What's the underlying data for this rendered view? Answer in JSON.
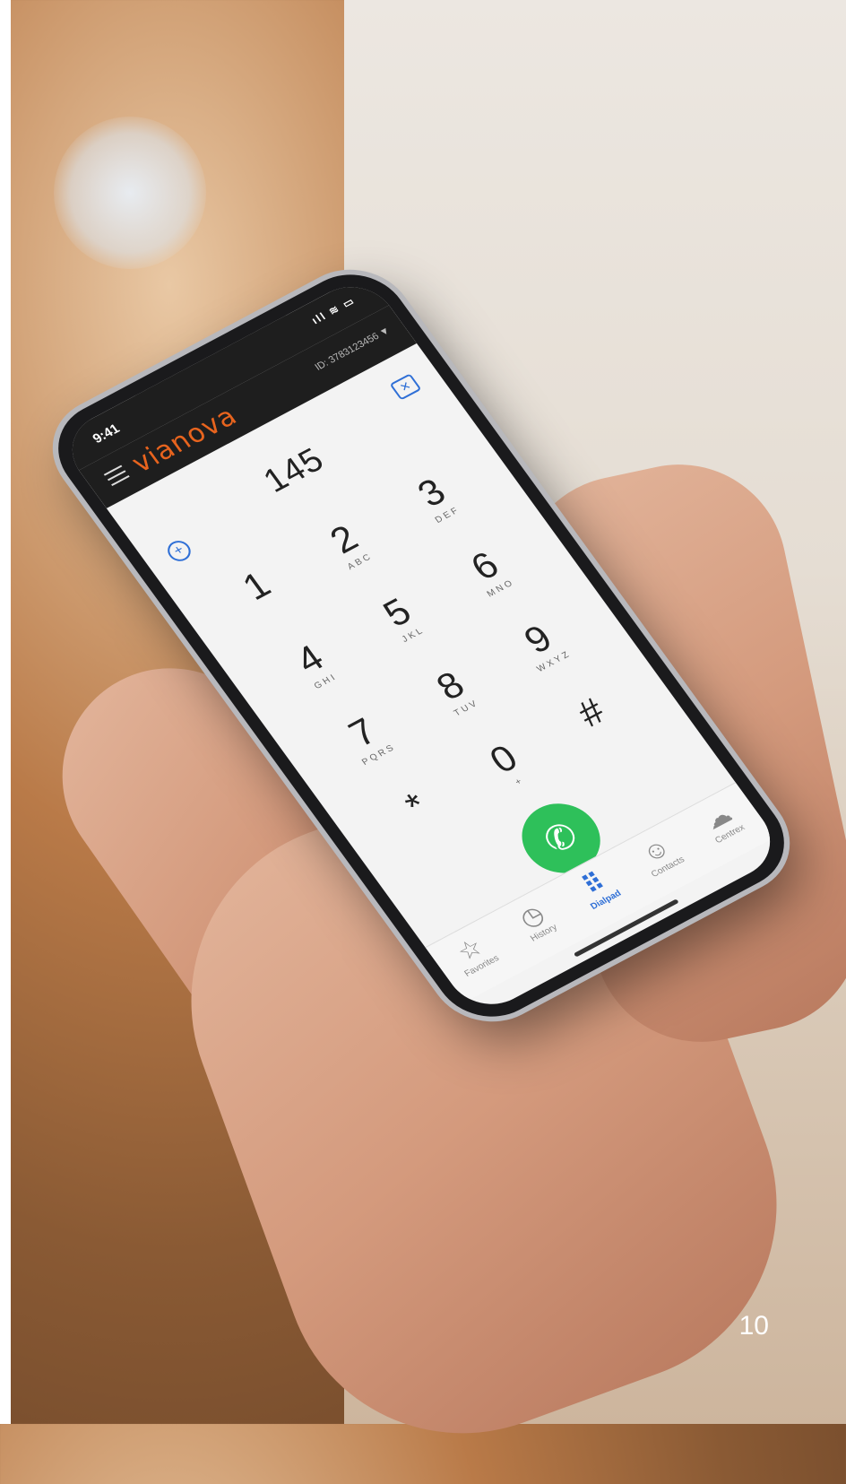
{
  "status": {
    "time": "9:41",
    "icons": "ıll ≋ ▭"
  },
  "app": {
    "logo": "vianova",
    "account_id": "ID: 3783123456 ▼"
  },
  "dialer": {
    "dialed_number": "145",
    "add_icon": "+",
    "clear_icon": "✕",
    "keys": [
      {
        "digit": "1",
        "letters": ""
      },
      {
        "digit": "2",
        "letters": "ABC"
      },
      {
        "digit": "3",
        "letters": "DEF"
      },
      {
        "digit": "4",
        "letters": "GHI"
      },
      {
        "digit": "5",
        "letters": "JKL"
      },
      {
        "digit": "6",
        "letters": "MNO"
      },
      {
        "digit": "7",
        "letters": "PQRS"
      },
      {
        "digit": "8",
        "letters": "TUV"
      },
      {
        "digit": "9",
        "letters": "WXYZ"
      },
      {
        "digit": "*",
        "letters": ""
      },
      {
        "digit": "0",
        "letters": "+"
      },
      {
        "digit": "#",
        "letters": ""
      }
    ],
    "call_icon": "✆"
  },
  "tabs": [
    {
      "label": "Favorites",
      "icon": "☆"
    },
    {
      "label": "History",
      "icon": "◷"
    },
    {
      "label": "Dialpad",
      "icon": "⠿"
    },
    {
      "label": "Contacts",
      "icon": "☺"
    },
    {
      "label": "Centrex",
      "icon": "☁"
    }
  ],
  "active_tab": "Dialpad",
  "colors": {
    "accent": "#2f6fd6",
    "brand": "#e8641e",
    "call": "#2ec05a"
  },
  "page_number": "10"
}
